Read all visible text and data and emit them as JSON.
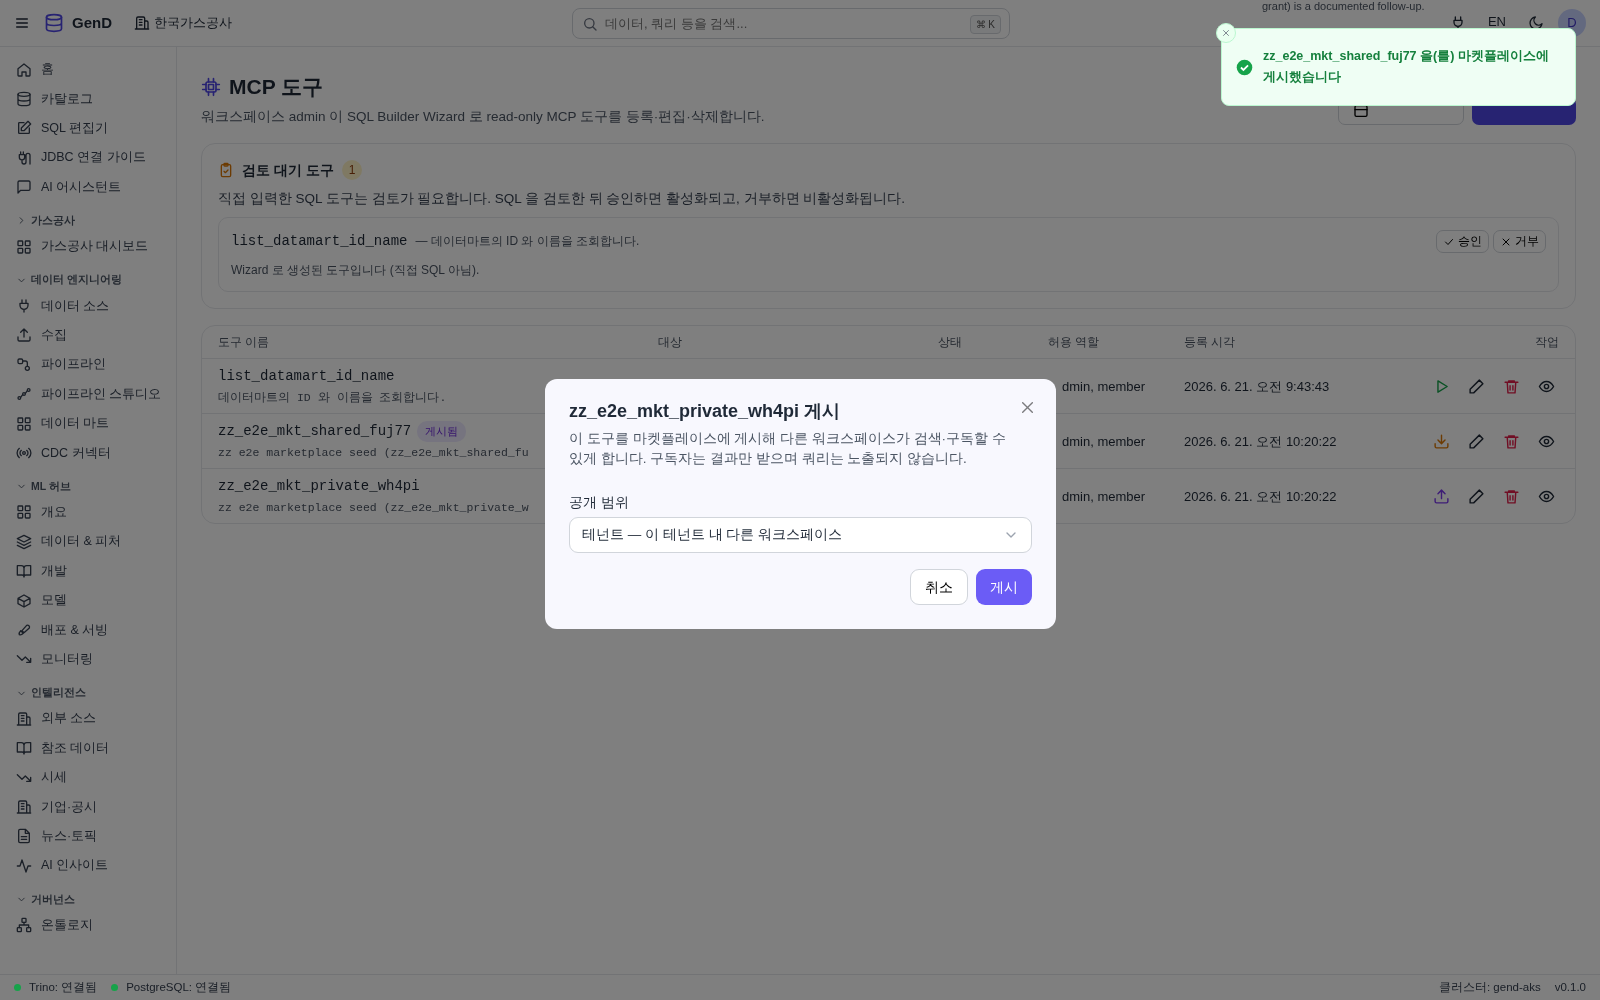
{
  "topbar": {
    "app_name": "GenD",
    "org": "한국가스공사",
    "search": {
      "placeholder": "데이터, 쿼리 등을 검색...",
      "shortcut": "⌘ K"
    },
    "language": "EN",
    "avatar": "D"
  },
  "sidebar": {
    "top_items": [
      {
        "label": "홈"
      },
      {
        "label": "카탈로그"
      },
      {
        "label": "SQL 편집기"
      },
      {
        "label": "JDBC 연결 가이드"
      },
      {
        "label": "AI 어시스턴트"
      }
    ],
    "sections": [
      {
        "title": "가스공사",
        "expanded": false,
        "items": [
          {
            "label": "가스공사 대시보드"
          }
        ]
      },
      {
        "title": "데이터 엔지니어링",
        "expanded": true,
        "items": [
          {
            "label": "데이터 소스"
          },
          {
            "label": "수집"
          },
          {
            "label": "파이프라인"
          },
          {
            "label": "파이프라인 스튜디오"
          },
          {
            "label": "데이터 마트"
          },
          {
            "label": "CDC 커넥터"
          }
        ]
      },
      {
        "title": "ML 허브",
        "expanded": true,
        "items": [
          {
            "label": "개요"
          },
          {
            "label": "데이터 & 피처"
          },
          {
            "label": "개발"
          },
          {
            "label": "모델"
          },
          {
            "label": "배포 & 서빙"
          },
          {
            "label": "모니터링"
          }
        ]
      },
      {
        "title": "인텔리전스",
        "expanded": true,
        "items": [
          {
            "label": "외부 소스"
          },
          {
            "label": "참조 데이터"
          },
          {
            "label": "시세"
          },
          {
            "label": "기업·공시"
          },
          {
            "label": "뉴스·토픽"
          },
          {
            "label": "AI 인사이트"
          }
        ]
      },
      {
        "title": "거버넌스",
        "expanded": true,
        "items": [
          {
            "label": "온톨로지"
          }
        ]
      }
    ]
  },
  "page": {
    "title": "MCP 도구",
    "subtitle": "워크스페이스 admin 이 SQL Builder Wizard 로 read-only MCP 도구를 등록·편집·삭제합니다."
  },
  "review": {
    "title": "검토 대기 도구",
    "count": "1",
    "description": "직접 입력한 SQL 도구는 검토가 필요합니다. SQL 을 검토한 뒤 승인하면 활성화되고, 거부하면 비활성화됩니다.",
    "items": [
      {
        "name": "list_datamart_id_name",
        "summary": "— 데이터마트의 ID 와 이름을 조회합니다.",
        "note": "Wizard 로 생성된 도구입니다 (직접 SQL 아님).",
        "approve": "승인",
        "reject": "거부"
      }
    ]
  },
  "table": {
    "columns": [
      "도구 이름",
      "대상",
      "상태",
      "허용 역할",
      "등록 시각",
      "작업"
    ],
    "rows": [
      {
        "name": "list_datamart_id_name",
        "badge": null,
        "description": "데이터마트의 ID 와 이름을 조회합니다.",
        "roles": "dmin, member",
        "registered": "2026. 6. 21. 오전 9:43:43",
        "kind": "run"
      },
      {
        "name": "zz_e2e_mkt_shared_fuj77",
        "badge": "게시됨",
        "description": "zz e2e marketplace seed (zz_e2e_mkt_shared_fu",
        "roles": "dmin, member",
        "registered": "2026. 6. 21. 오전 10:20:22",
        "kind": "unpublish"
      },
      {
        "name": "zz_e2e_mkt_private_wh4pi",
        "badge": null,
        "description": "zz e2e marketplace seed (zz_e2e_mkt_private_w",
        "roles": "dmin, member",
        "registered": "2026. 6. 21. 오전 10:20:22",
        "kind": "publish"
      }
    ]
  },
  "modal": {
    "title": "zz_e2e_mkt_private_wh4pi 게시",
    "description": "이 도구를 마켓플레이스에 게시해 다른 워크스페이스가 검색·구독할 수 있게 합니다. 구독자는 결과만 받으며 쿼리는 노출되지 않습니다.",
    "field_label": "공개 범위",
    "select_value": "테넌트 — 이 테넌트 내 다른 워크스페이스",
    "buttons": [
      {
        "label": "취소",
        "kind": "secondary"
      },
      {
        "label": "게시",
        "kind": "primary"
      }
    ]
  },
  "toast": {
    "message": "zz_e2e_mkt_shared_fuj77 을(를) 마켓플레이스에 게시했습니다",
    "kind": "success"
  },
  "background_toast": {
    "message": "grant) is a documented follow-up."
  },
  "status_bar": {
    "connections": [
      {
        "label": "Trino: 연결됨",
        "color": "#16a34a"
      },
      {
        "label": "PostgreSQL: 연결됨",
        "color": "#16a34a"
      }
    ],
    "cluster": "클러스터: gend-aks",
    "version": "v0.1.0"
  }
}
